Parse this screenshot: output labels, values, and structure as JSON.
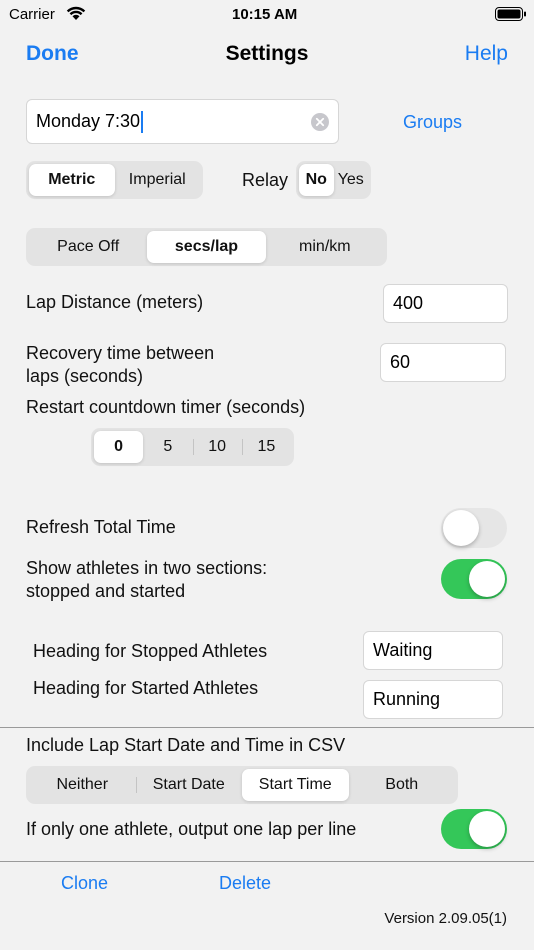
{
  "status_bar": {
    "carrier": "Carrier",
    "time": "10:15 AM"
  },
  "nav": {
    "done": "Done",
    "title": "Settings",
    "help": "Help"
  },
  "session": {
    "name_value": "Monday 7:30",
    "groups_link": "Groups"
  },
  "units": {
    "options": [
      "Metric",
      "Imperial"
    ],
    "selected": "Metric"
  },
  "relay": {
    "label": "Relay",
    "options": [
      "No",
      "Yes"
    ],
    "selected": "No"
  },
  "pace": {
    "options": [
      "Pace Off",
      "secs/lap",
      "min/km"
    ],
    "selected": "secs/lap"
  },
  "lap_distance": {
    "label": "Lap Distance (meters)",
    "value": "400"
  },
  "recovery": {
    "label_line1": "Recovery time between",
    "label_line2": "laps (seconds)",
    "value": "60"
  },
  "restart": {
    "label": "Restart countdown timer (seconds)",
    "options": [
      "0",
      "5",
      "10",
      "15"
    ],
    "selected": "0"
  },
  "refresh": {
    "label": "Refresh Total Time",
    "on": false
  },
  "two_sections": {
    "label_line1": "Show athletes in two sections:",
    "label_line2": "stopped and started",
    "on": true
  },
  "stopped_heading": {
    "label": "Heading for Stopped Athletes",
    "value": "Waiting"
  },
  "started_heading": {
    "label": "Heading for Started Athletes",
    "value": "Running"
  },
  "csv": {
    "label": "Include Lap Start Date and Time in CSV",
    "options": [
      "Neither",
      "Start Date",
      "Start Time",
      "Both"
    ],
    "selected": "Start Time"
  },
  "one_lap": {
    "label": "If only one athlete, output one lap per line",
    "on": true
  },
  "actions": {
    "clone": "Clone",
    "delete": "Delete"
  },
  "version": "Version 2.09.05(1)",
  "colors": {
    "accent": "#1a7cf2",
    "toggle_on": "#34c759",
    "toggle_off": "#e6e6e6",
    "background": "#f2f2f2"
  }
}
